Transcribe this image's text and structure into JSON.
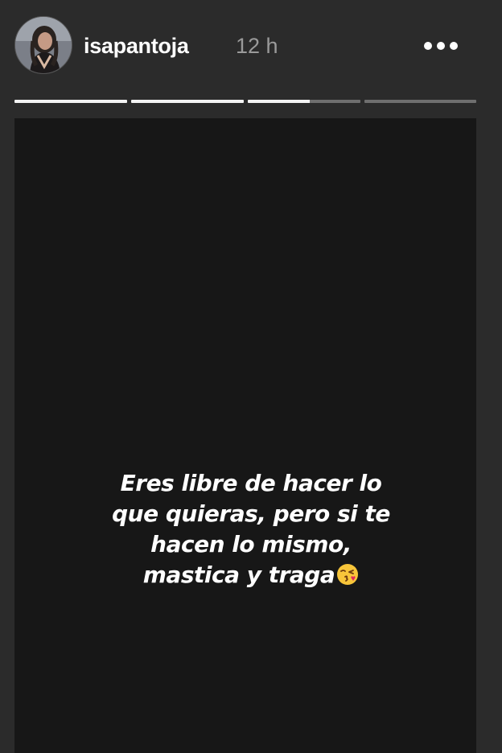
{
  "header": {
    "username": "isapantoja",
    "time": "12 h",
    "avatar_icon": "profile-photo",
    "more_icon": "more-options-icon"
  },
  "progress": {
    "segments": [
      1,
      1,
      0.55,
      0
    ]
  },
  "story": {
    "caption_lines": [
      "Eres libre de hacer lo",
      "que quieras, pero si te",
      "hacen lo mismo,",
      "mastica y traga"
    ],
    "emoji": "face-blowing-a-kiss"
  },
  "colors": {
    "background": "#2b2b2b",
    "story_background": "#171717",
    "progress_track": "#6f6f6f",
    "progress_fill": "#f4f4f4",
    "time_text": "#9a9a9a"
  }
}
